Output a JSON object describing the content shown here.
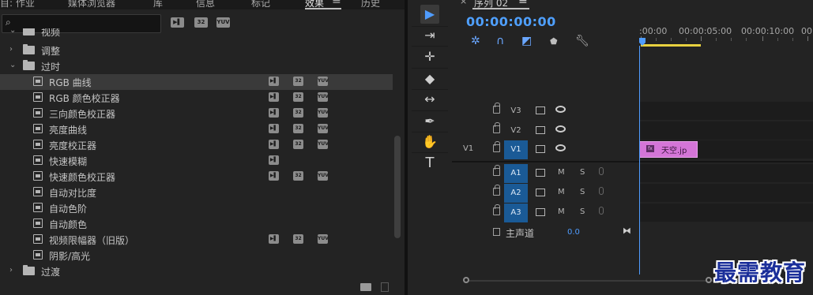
{
  "effects_panel": {
    "tabs": [
      "目: 作业",
      "媒体浏览器",
      "库",
      "信息",
      "标记",
      "效果",
      "历史"
    ],
    "active_tab": "效果",
    "menu_icon": "hamburger-icon",
    "search": {
      "placeholder": "",
      "icon": "search-icon"
    },
    "filter_badges": [
      "accelerated-icon",
      "32",
      "YUV"
    ],
    "tree": [
      {
        "type": "folder",
        "label": "视频",
        "expanded": true,
        "level": 1
      },
      {
        "type": "folder",
        "label": "调整",
        "expanded": false,
        "level": 1
      },
      {
        "type": "folder",
        "label": "过时",
        "expanded": true,
        "level": 1
      },
      {
        "type": "effect",
        "label": "RGB 曲线",
        "badges": [
          true,
          true,
          true
        ],
        "selected": true
      },
      {
        "type": "effect",
        "label": "RGB 颜色校正器",
        "badges": [
          true,
          true,
          true
        ]
      },
      {
        "type": "effect",
        "label": "三向颜色校正器",
        "badges": [
          true,
          true,
          true
        ]
      },
      {
        "type": "effect",
        "label": "亮度曲线",
        "badges": [
          true,
          true,
          true
        ]
      },
      {
        "type": "effect",
        "label": "亮度校正器",
        "badges": [
          true,
          true,
          true
        ]
      },
      {
        "type": "effect",
        "label": "快速模糊",
        "badges": [
          true,
          false,
          false
        ]
      },
      {
        "type": "effect",
        "label": "快速颜色校正器",
        "badges": [
          true,
          true,
          true
        ]
      },
      {
        "type": "effect",
        "label": "自动对比度",
        "badges": [
          false,
          false,
          false
        ]
      },
      {
        "type": "effect",
        "label": "自动色阶",
        "badges": [
          false,
          false,
          false
        ]
      },
      {
        "type": "effect",
        "label": "自动颜色",
        "badges": [
          false,
          false,
          false
        ]
      },
      {
        "type": "effect",
        "label": "视频限幅器（旧版）",
        "badges": [
          true,
          true,
          true
        ]
      },
      {
        "type": "effect",
        "label": "阴影/高光",
        "badges": [
          false,
          false,
          false
        ]
      },
      {
        "type": "folder",
        "label": "过渡",
        "expanded": false,
        "level": 0
      }
    ],
    "badge_text": [
      "accelerated-icon",
      "32",
      "YUV"
    ]
  },
  "tools": [
    {
      "name": "selection-tool-icon",
      "glyph": "▶",
      "active": true
    },
    {
      "name": "track-select-icon",
      "glyph": "⇥"
    },
    {
      "name": "ripple-edit-icon",
      "glyph": "✛"
    },
    {
      "name": "razor-icon",
      "glyph": "◆"
    },
    {
      "name": "slip-icon",
      "glyph": "↔"
    },
    {
      "name": "pen-icon",
      "glyph": "✒"
    },
    {
      "name": "hand-icon",
      "glyph": "✋"
    },
    {
      "name": "type-icon",
      "glyph": "T"
    }
  ],
  "timeline": {
    "sequence_tab": "序列 02",
    "close_glyph": "×",
    "menu_icon": "hamburger-icon",
    "timecode": "00:00:00:00",
    "ruler_labels": [
      ":00:00",
      "00:00:05:00",
      "00:00:10:00",
      "00"
    ],
    "video_tracks": [
      {
        "target": "V3",
        "source": "",
        "targeted": false
      },
      {
        "target": "V2",
        "source": "",
        "targeted": false
      },
      {
        "target": "V1",
        "source": "V1",
        "targeted": true
      }
    ],
    "audio_tracks": [
      {
        "target": "A1",
        "targeted": true
      },
      {
        "target": "A2",
        "targeted": true
      },
      {
        "target": "A3",
        "targeted": true
      }
    ],
    "mute_label": "M",
    "solo_label": "S",
    "clip": {
      "name": "天空.jp",
      "fx_badge": "fx",
      "color": "#d475d7"
    },
    "master": {
      "label": "主声道",
      "value": "0.0"
    }
  },
  "watermark": "最需教育",
  "colors": {
    "accent": "#4f9cff",
    "target_on": "#1a5a96",
    "clip": "#d475d7",
    "work_area": "#e8d13f"
  }
}
